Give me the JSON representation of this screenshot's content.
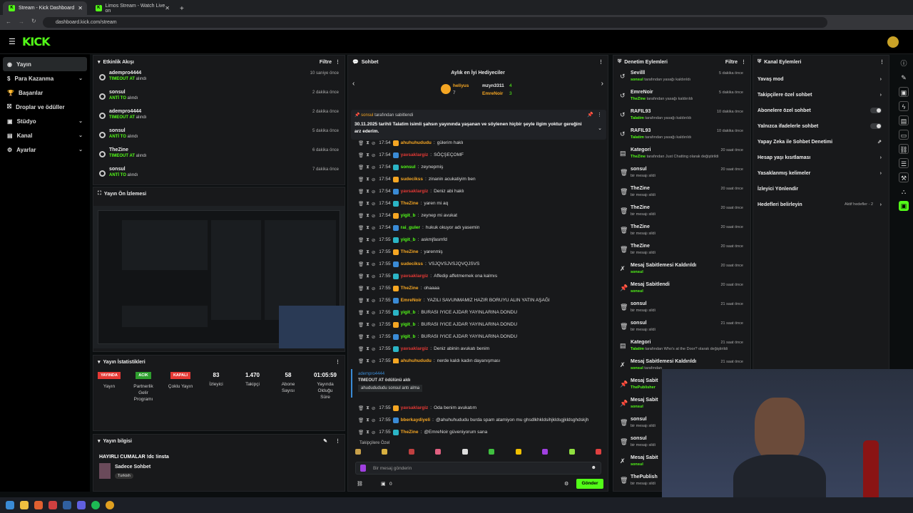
{
  "browser": {
    "tabs": [
      {
        "title": "Stream - Kick Dashboard",
        "active": true
      },
      {
        "title": "Limos Stream - Watch Live on",
        "active": false
      }
    ],
    "url": "dashboard.kick.com/stream"
  },
  "brand": {
    "logo": "KICK",
    "accent": "#53fc18"
  },
  "sidebar": {
    "items": [
      {
        "label": "Yayın",
        "icon": "broadcast-icon",
        "active": true
      },
      {
        "label": "Para Kazanma",
        "icon": "money-icon",
        "chevron": true
      },
      {
        "label": "Başarılar",
        "icon": "trophy-icon"
      },
      {
        "label": "Droplar ve ödüller",
        "icon": "gift-icon"
      },
      {
        "label": "Stüdyo",
        "icon": "studio-icon",
        "chevron": true
      },
      {
        "label": "Kanal",
        "icon": "channel-icon",
        "chevron": true
      },
      {
        "label": "Ayarlar",
        "icon": "settings-icon",
        "chevron": true
      }
    ]
  },
  "activity": {
    "title": "Etkinlik Akışı",
    "filter": "Filtre",
    "rows": [
      {
        "user": "adempro4444",
        "action_b": "TIMEOUT AT",
        "action": " alındı",
        "time": "10 saniye önce"
      },
      {
        "user": "sonsul",
        "action_b": "ANTİ TO",
        "action": " alındı",
        "time": "2 dakika önce"
      },
      {
        "user": "adempro4444",
        "action_b": "TIMEOUT AT",
        "action": " alındı",
        "time": "2 dakika önce"
      },
      {
        "user": "sonsul",
        "action_b": "ANTİ TO",
        "action": " alındı",
        "time": "5 dakika önce"
      },
      {
        "user": "TheZine",
        "action_b": "TIMEOUT AT",
        "action": " alındı",
        "time": "6 dakika önce"
      },
      {
        "user": "sonsul",
        "action_b": "ANTİ TO",
        "action": " alındı",
        "time": "7 dakika önce"
      }
    ]
  },
  "preview": {
    "title": "Yayın Ön İzlemesi"
  },
  "stats": {
    "title": "Yayın İstatistikleri",
    "items": [
      {
        "value": "YAYINDA",
        "label": "Yayın",
        "type": "badge",
        "color": "#e53935"
      },
      {
        "value": "ACIK",
        "label": "Partnerlik Gelir Programı",
        "type": "badge",
        "color": "#2e9e2e"
      },
      {
        "value": "KAPALI",
        "label": "Çoklu Yayın",
        "type": "badge",
        "color": "#e53935"
      },
      {
        "value": "83",
        "label": "İzleyici"
      },
      {
        "value": "1.470",
        "label": "Takipçi"
      },
      {
        "value": "58",
        "label": "Abone Sayısı"
      },
      {
        "value": "01:05:59",
        "label": "Yayında Olduğu Süre"
      }
    ]
  },
  "stream_info": {
    "title": "Yayın bilgisi",
    "stream_title": "HAYIRLI CUMALAR !dc !insta",
    "category": "Sadece Sohbet",
    "language": "Turkish"
  },
  "chat": {
    "title": "Sohbet",
    "top_gifters_title": "Aylık en İyi Hediyeciler",
    "gifters": [
      {
        "name": "heliyus",
        "count": "7"
      },
      {
        "name": "mzyn3311",
        "count": "4"
      },
      {
        "name": "EmreNoir",
        "count": "3"
      }
    ],
    "pinned": {
      "by": "sonsul",
      "by_suffix": "tarafından sabitlendi",
      "text": "30.11.2025 tarihli Talatim isimli şahsın yayınında yaşanan ve söylenen hiçbir şeyle ilgim yoktur gereğini arz ederim."
    },
    "messages": [
      {
        "time": "17:54",
        "user": "ahuhuhududu",
        "color": "#f5a623",
        "text": "gülerim haklı"
      },
      {
        "time": "17:54",
        "user": "yavsaklargiz",
        "color": "#e53935",
        "text": "SÖÇŞEÇOMF"
      },
      {
        "time": "17:54",
        "user": "sonsul",
        "color": "#53fc18",
        "text": "zeynepmiş"
      },
      {
        "time": "17:54",
        "user": "sudecikss",
        "color": "#f5a623",
        "text": "zinanin acukatiyim ben"
      },
      {
        "time": "17:54",
        "user": "yavsaklargiz",
        "color": "#e53935",
        "text": "Deniz abi haklı"
      },
      {
        "time": "17:54",
        "user": "TheZine",
        "color": "#f5a623",
        "text": "yaren mi aq"
      },
      {
        "time": "17:54",
        "user": "yigit_b",
        "color": "#53fc18",
        "text": "zeynep mi avukat"
      },
      {
        "time": "17:54",
        "user": "rai_guler",
        "color": "#53fc18",
        "text": "hukuk okuyor adı yasemin"
      },
      {
        "time": "17:55",
        "user": "yigit_b",
        "color": "#53fc18",
        "text": "askmjfasmfd"
      },
      {
        "time": "17:55",
        "user": "TheZine",
        "color": "#f5a623",
        "text": "yarenmiş"
      },
      {
        "time": "17:55",
        "user": "sudecikss",
        "color": "#f5a623",
        "text": "VSJQVSJVSJQVQJSVS"
      },
      {
        "time": "17:55",
        "user": "yavsaklargiz",
        "color": "#e53935",
        "text": "Affedip affetmemek ona kalmıs"
      },
      {
        "time": "17:55",
        "user": "TheZine",
        "color": "#f5a623",
        "text": "ohaaaa"
      },
      {
        "time": "17:55",
        "user": "EmreNoir",
        "color": "#f5a623",
        "text": "YAZILI SAVUNMAMIZ HAZIR BORUYU ALIN YATIN AŞAĞI"
      },
      {
        "time": "17:55",
        "user": "yigit_b",
        "color": "#53fc18",
        "text": "BURASI IYICE AJDAR YAYINLARINA DONDU"
      },
      {
        "time": "17:55",
        "user": "yigit_b",
        "color": "#53fc18",
        "text": "BURASI IYICE AJDAR YAYINLARINA DONDU"
      },
      {
        "time": "17:55",
        "user": "yigit_b",
        "color": "#53fc18",
        "text": "BURASI IYICE AJDAR YAYINLARINA DONDU"
      },
      {
        "time": "17:55",
        "user": "yavsaklargiz",
        "color": "#e53935",
        "text": "Deniz abinin avukatı benim"
      },
      {
        "time": "17:55",
        "user": "ahuhuhududu",
        "color": "#f5a623",
        "text": "nerde kaldı kadın dayanışması"
      }
    ],
    "timeout_event": {
      "user": "adempro4444",
      "line": "TIMEOUT AT ödülünü aldı",
      "msg": "ahududududu sonsul antı alma"
    },
    "messages2": [
      {
        "time": "17:55",
        "user": "yavsaklargiz",
        "color": "#e53935",
        "text": "Oda benim avukatım"
      },
      {
        "time": "17:55",
        "user": "bberkaydiyeli",
        "color": "#f5a623",
        "text": "@ahuhuhududu burda spam atamiyon mu ghsdlkhkldsihjkldsgjkldsghdskjh"
      },
      {
        "time": "17:55",
        "user": "TheZine",
        "color": "#f5a623",
        "text": "@EmreNoir güveniyorum sana"
      }
    ],
    "followers_only": "Takipçilere Özel",
    "input_placeholder": "Bir mesaj gönderin",
    "points": "0",
    "send": "Gönder"
  },
  "modlog": {
    "title": "Denetim Eylemleri",
    "filter": "Filtre",
    "rows": [
      {
        "icon": "undo-icon",
        "user": "Sevilll",
        "by": "sonsul",
        "desc": " tarafından yasağı kaldırıldı",
        "time": "5 dakika önce"
      },
      {
        "icon": "undo-icon",
        "user": "EmreNoir",
        "by": "TheZine",
        "desc": " tarafından yasağı kaldırıldı",
        "time": "5 dakika önce"
      },
      {
        "icon": "undo-icon",
        "user": "RAFIL93",
        "by": "Talatim",
        "desc": " tarafından yasağı kaldırıldı",
        "time": "10 dakika önce"
      },
      {
        "icon": "undo-icon",
        "user": "RAFIL93",
        "by": "Talatim",
        "desc": " tarafından yasağı kaldırıldı",
        "time": "10 dakika önce"
      },
      {
        "icon": "category-icon",
        "user": "Kategori",
        "by": "TheZine",
        "desc": " tarafından Just Chatting olarak değiştirildi",
        "time": "20 saat önce"
      },
      {
        "icon": "trash-icon",
        "user": "sonsul",
        "by": "",
        "desc": "bir mesajı sildi",
        "time": "20 saat önce"
      },
      {
        "icon": "trash-icon",
        "user": "TheZine",
        "by": "",
        "desc": "bir mesajı sildi",
        "time": "20 saat önce"
      },
      {
        "icon": "trash-icon",
        "user": "TheZine",
        "by": "",
        "desc": "bir mesajı sildi",
        "time": "20 saat önce"
      },
      {
        "icon": "trash-icon",
        "user": "TheZine",
        "by": "",
        "desc": "bir mesajı sildi",
        "time": "20 saat önce"
      },
      {
        "icon": "trash-icon",
        "user": "TheZine",
        "by": "",
        "desc": "bir mesajı sildi",
        "time": "20 saat önce"
      },
      {
        "icon": "unpin-icon",
        "user": "Mesaj Sabitlemesi Kaldırıldı",
        "by": "sonsul",
        "desc": "",
        "time": "20 saat önce"
      },
      {
        "icon": "pin-icon",
        "user": "Mesaj Sabitlendi",
        "by": "sonsul",
        "desc": "",
        "time": "20 saat önce"
      },
      {
        "icon": "trash-icon",
        "user": "sonsul",
        "by": "",
        "desc": "bir mesajı sildi",
        "time": "21 saat önce"
      },
      {
        "icon": "trash-icon",
        "user": "sonsul",
        "by": "",
        "desc": "bir mesajı sildi",
        "time": "21 saat önce"
      },
      {
        "icon": "category-icon",
        "user": "Kategori",
        "by": "Talatim",
        "desc": " tarafından Who's at the Door? olarak değiştirildi",
        "time": "21 saat önce"
      },
      {
        "icon": "unpin-icon",
        "user": "Mesaj Sabitlemesi Kaldırıldı",
        "by": "sonsul",
        "desc": " tarafından",
        "time": "21 saat önce"
      },
      {
        "icon": "pin-icon",
        "user": "Mesaj Sabit",
        "by": "ThePublisher",
        "desc": "",
        "time": ""
      },
      {
        "icon": "pin-icon",
        "user": "Mesaj Sabit",
        "by": "sonsul",
        "desc": "",
        "time": ""
      },
      {
        "icon": "trash-icon",
        "user": "sonsul",
        "by": "",
        "desc": "bir mesajı sildi",
        "time": ""
      },
      {
        "icon": "trash-icon",
        "user": "sonsul",
        "by": "",
        "desc": "bir mesajı sildi",
        "time": ""
      },
      {
        "icon": "unpin-icon",
        "user": "Mesaj Sabit",
        "by": "sonsul",
        "desc": "",
        "time": ""
      },
      {
        "icon": "trash-icon",
        "user": "ThePublish",
        "by": "",
        "desc": "bir mesajı sildi",
        "time": ""
      },
      {
        "icon": "trash-icon",
        "user": "sonsul",
        "by": "",
        "desc": "bir mesajı sildi",
        "time": ""
      }
    ]
  },
  "channel_actions": {
    "title": "Kanal Eylemleri",
    "items": [
      {
        "label": "Yavaş mod",
        "ctrl": "chevron"
      },
      {
        "label": "Takipçilere özel sohbet",
        "ctrl": "chevron"
      },
      {
        "label": "Abonelere özel sohbet",
        "ctrl": "toggle"
      },
      {
        "label": "Yalnızca ifadelerle sohbet",
        "ctrl": "toggle"
      },
      {
        "label": "Yapay Zeka ile Sohbet Denetimi",
        "ctrl": "external"
      },
      {
        "label": "Hesap yaşı kısıtlaması",
        "ctrl": "chevron"
      },
      {
        "label": "Yasaklanmış kelimeler",
        "ctrl": "chevron"
      },
      {
        "label": "İzleyici Yönlendir",
        "ctrl": "none"
      },
      {
        "label": "Hedefleri belirleyin",
        "ctrl": "chevron",
        "extra": "Aktif hedefler - 2"
      }
    ]
  }
}
